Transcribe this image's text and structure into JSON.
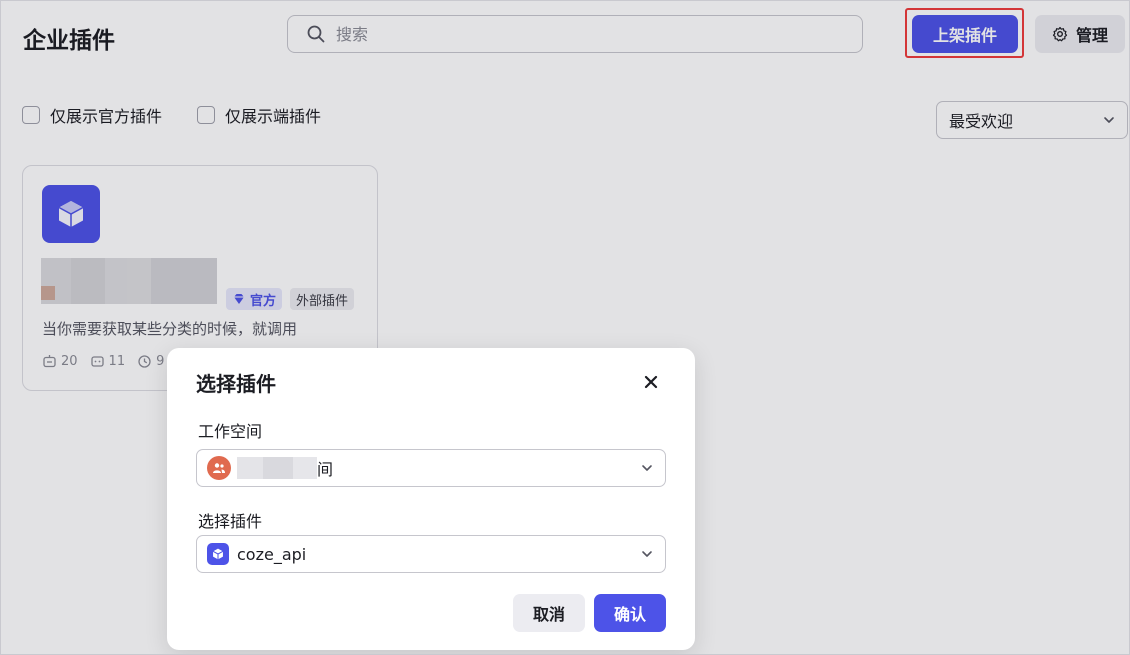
{
  "header": {
    "title": "企业插件",
    "search_placeholder": "搜索",
    "list_plugin_label": "上架插件",
    "manage_label": "管理"
  },
  "filters": {
    "official_only_label": "仅展示官方插件",
    "client_only_label": "仅展示端插件",
    "sort_selected": "最受欢迎"
  },
  "card": {
    "badge_official": "官方",
    "badge_external": "外部插件",
    "description": "当你需要获取某些分类的时候，就调用",
    "stats": [
      "20",
      "11",
      "9"
    ]
  },
  "modal": {
    "title": "选择插件",
    "workspace_label": "工作空间",
    "workspace_value_suffix": "间",
    "plugin_label": "选择插件",
    "plugin_value": "coze_api",
    "cancel_label": "取消",
    "confirm_label": "确认"
  },
  "colors": {
    "brand": "#4d53e8",
    "highlight": "#ee3b3b",
    "workspace_avatar": "#e06a4f"
  }
}
